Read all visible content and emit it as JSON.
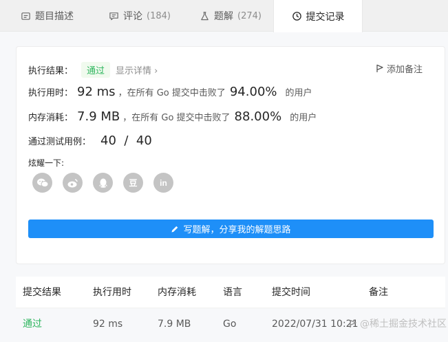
{
  "tabs": [
    {
      "label": "题目描述",
      "count": "",
      "icon": "document-icon"
    },
    {
      "label": "评论",
      "count": "(184)",
      "icon": "comment-icon"
    },
    {
      "label": "题解",
      "count": "(274)",
      "icon": "flask-icon"
    },
    {
      "label": "提交记录",
      "count": "",
      "icon": "clock-icon"
    }
  ],
  "result": {
    "label": "执行结果：",
    "status": "通过",
    "details_link": "显示详情 ›",
    "add_note": "添加备注"
  },
  "runtime": {
    "label": "执行用时：",
    "value": "92 ms",
    "middle": "，在所有 Go 提交中击败了",
    "percent": "94.00%",
    "suffix": "的用户"
  },
  "memory": {
    "label": "内存消耗：",
    "value": "7.9 MB",
    "middle": "，在所有 Go 提交中击败了",
    "percent": "88.00%",
    "suffix": "的用户"
  },
  "testcases": {
    "label": "通过测试用例：",
    "value": "40  /  40"
  },
  "share": {
    "label": "炫耀一下:",
    "icons": [
      "wechat-icon",
      "weibo-icon",
      "qq-icon",
      "douban-icon",
      "linkedin-icon"
    ],
    "douban_glyph": "豆",
    "linkedin_glyph": "in"
  },
  "cta": {
    "label": "写题解，分享我的解题思路"
  },
  "table": {
    "headers": [
      "提交结果",
      "执行用时",
      "内存消耗",
      "语言",
      "提交时间",
      "备注"
    ],
    "rows": [
      {
        "result": "通过",
        "time": "92 ms",
        "memory": "7.9 MB",
        "language": "Go",
        "submitted": "2022/07/31 10:21"
      }
    ]
  },
  "watermark": "@稀土掘金技术社区",
  "colors": {
    "accent": "#1e8ff8",
    "success": "#2db55d"
  }
}
